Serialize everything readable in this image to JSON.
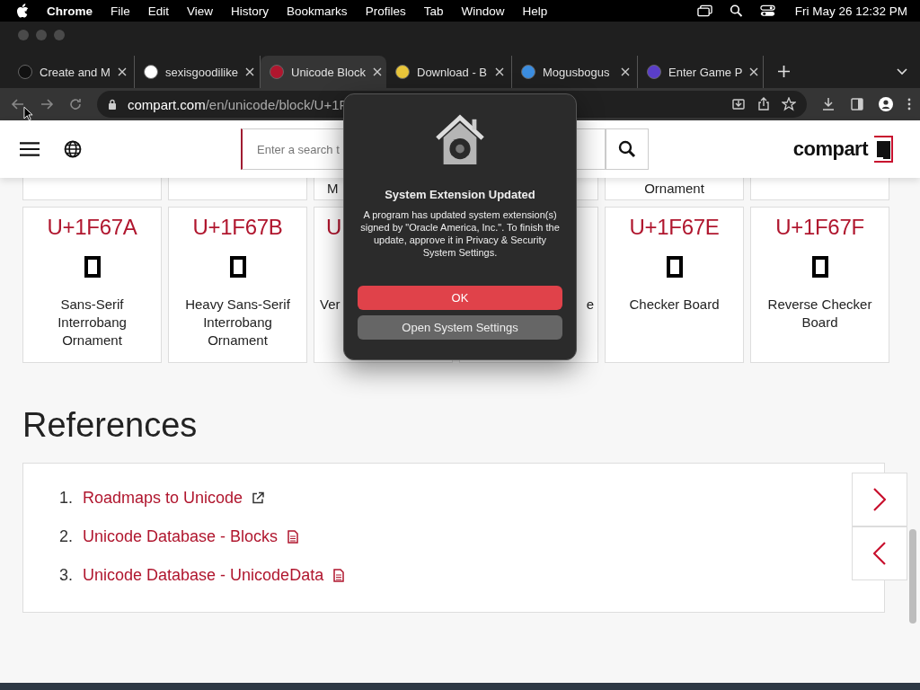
{
  "menu_bar": {
    "app": "Chrome",
    "items": [
      "File",
      "Edit",
      "View",
      "History",
      "Bookmarks",
      "Profiles",
      "Tab",
      "Window",
      "Help"
    ],
    "clock": "Fri May 26  12:32 PM"
  },
  "tabs": [
    {
      "title": "Create and M",
      "selected": false
    },
    {
      "title": "sexisgoodilike",
      "selected": false
    },
    {
      "title": "Unicode Block",
      "selected": true
    },
    {
      "title": "Download - B",
      "selected": false
    },
    {
      "title": "Mogusbogus",
      "selected": false
    },
    {
      "title": "Enter Game P",
      "selected": false
    }
  ],
  "address": {
    "domain": "compart.com",
    "path": "/en/unicode/block/U+1F"
  },
  "site_header": {
    "search_placeholder": "Enter a search t",
    "logo": "compart"
  },
  "top_row": [
    {
      "name": "M"
    },
    {
      "name": "Ornament"
    }
  ],
  "cards": [
    {
      "code": "U+1F67A",
      "name": "Sans-Serif Interrobang Ornament"
    },
    {
      "code": "U+1F67B",
      "name": "Heavy Sans-Serif Interrobang Ornament"
    },
    {
      "code": "U",
      "name": "Ver"
    },
    {
      "name": "e"
    },
    {
      "code": "U+1F67E",
      "name": "Checker Board"
    },
    {
      "code": "U+1F67F",
      "name": "Reverse Checker Board"
    }
  ],
  "references": {
    "heading": "References",
    "items": [
      {
        "number": "1.",
        "text": "Roadmaps to Unicode"
      },
      {
        "number": "2.",
        "text": "Unicode Database - Blocks"
      },
      {
        "number": "3.",
        "text": "Unicode Database - UnicodeData"
      }
    ]
  },
  "dialog": {
    "title": "System Extension Updated",
    "message": "A program has updated system extension(s) signed by \"Oracle America, Inc.\". To finish the update, approve it in Privacy & Security System Settings.",
    "buttons": [
      {
        "label": "OK",
        "kind": "primary"
      },
      {
        "label": "Open System Settings",
        "kind": "secondary"
      }
    ]
  }
}
